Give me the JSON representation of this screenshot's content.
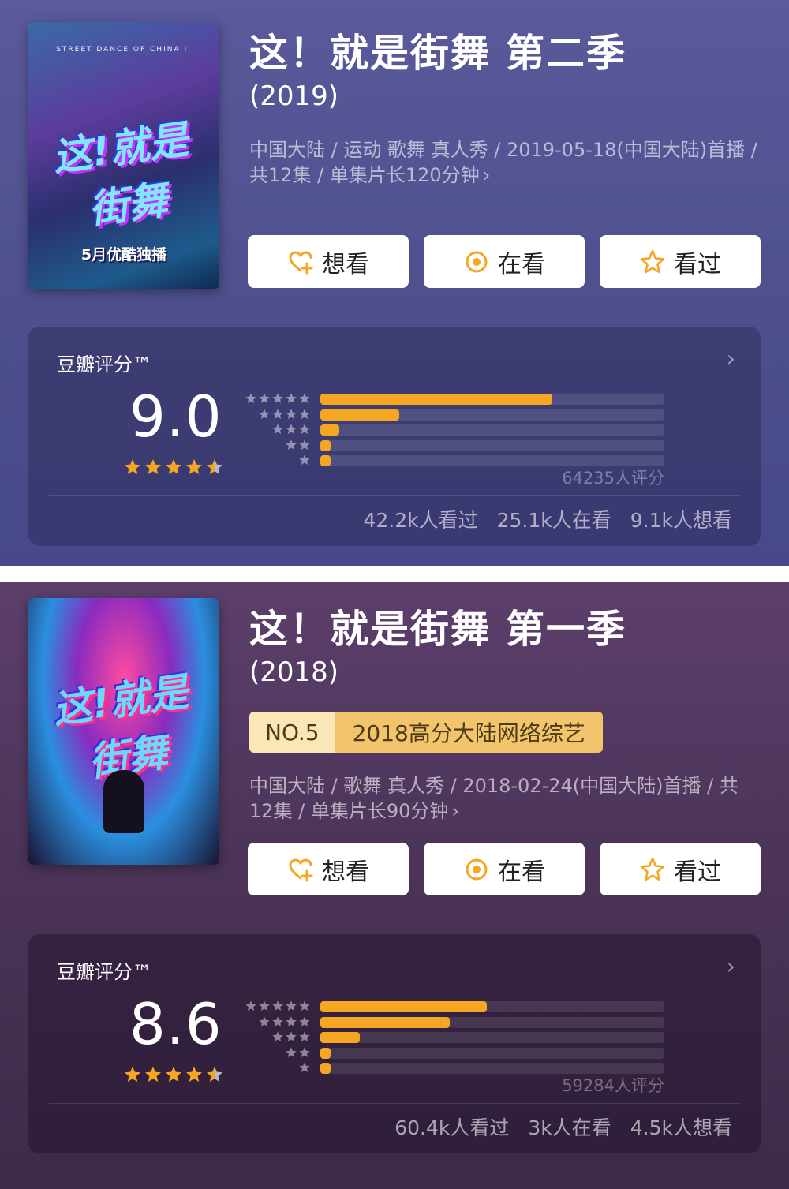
{
  "colors": {
    "accent": "#f5a623",
    "panel_0_bg": "#524f92",
    "panel_1_bg": "#4a3357"
  },
  "shows": [
    {
      "title": "这！就是街舞 第二季",
      "year": "(2019)",
      "poster": {
        "top_text": "STREET DANCE OF CHINA II",
        "logo_text": "这!就是街舞",
        "bottom_text": "5月优酷独播"
      },
      "ranking": null,
      "meta": "中国大陆 / 运动 歌舞 真人秀 / 2019-05-18(中国大陆)首播 / 共12集 / 单集片长120分钟",
      "actions": [
        {
          "label": "想看",
          "icon": "heart-plus-icon"
        },
        {
          "label": "在看",
          "icon": "circle-dot-icon"
        },
        {
          "label": "看过",
          "icon": "star-outline-icon"
        }
      ],
      "rating": {
        "label": "豆瓣评分™",
        "score": "9.0",
        "stars": 4.5,
        "distribution": [
          {
            "stars": 5,
            "fraction": 0.675
          },
          {
            "stars": 4,
            "fraction": 0.23
          },
          {
            "stars": 3,
            "fraction": 0.055
          },
          {
            "stars": 2,
            "fraction": 0.025
          },
          {
            "stars": 1,
            "fraction": 0.025
          }
        ],
        "count_text": "64235人评分",
        "stats": [
          "42.2k人看过",
          "25.1k人在看",
          "9.1k人想看"
        ]
      }
    },
    {
      "title": "这！就是街舞 第一季",
      "year": "(2018)",
      "poster": {
        "top_text": "",
        "logo_text": "这!就是街舞",
        "bottom_text": ""
      },
      "ranking": {
        "rank": "NO.5",
        "text": "2018高分大陆网络综艺"
      },
      "meta": "中国大陆 / 歌舞 真人秀 / 2018-02-24(中国大陆)首播 / 共12集 / 单集片长90分钟",
      "actions": [
        {
          "label": "想看",
          "icon": "heart-plus-icon"
        },
        {
          "label": "在看",
          "icon": "circle-dot-icon"
        },
        {
          "label": "看过",
          "icon": "star-outline-icon"
        }
      ],
      "rating": {
        "label": "豆瓣评分™",
        "score": "8.6",
        "stars": 4.5,
        "distribution": [
          {
            "stars": 5,
            "fraction": 0.485
          },
          {
            "stars": 4,
            "fraction": 0.375
          },
          {
            "stars": 3,
            "fraction": 0.115
          },
          {
            "stars": 2,
            "fraction": 0.025
          },
          {
            "stars": 1,
            "fraction": 0.025
          }
        ],
        "count_text": "59284人评分",
        "stats": [
          "60.4k人看过",
          "3k人在看",
          "4.5k人想看"
        ]
      }
    }
  ]
}
